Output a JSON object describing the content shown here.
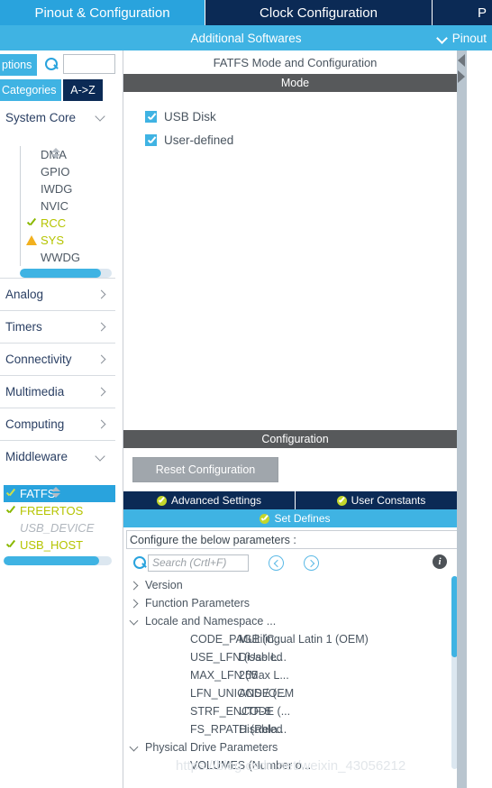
{
  "tabs": [
    {
      "label": "Pinout & Configuration",
      "active": true
    },
    {
      "label": "Clock Configuration",
      "active": false
    },
    {
      "label": "P",
      "active": false
    }
  ],
  "subbar": {
    "title": "Additional Softwares",
    "pinout_label": "Pinout",
    "chevron_icon": "chevron-down-icon"
  },
  "sidebar": {
    "options_label": "ptions",
    "search_value": "",
    "categories_label": "Categories",
    "az_label": "A->Z",
    "groups": [
      {
        "label": "System Core",
        "expanded": true,
        "items": [
          {
            "label": "DMA",
            "state": "none"
          },
          {
            "label": "GPIO",
            "state": "none"
          },
          {
            "label": "IWDG",
            "state": "none"
          },
          {
            "label": "NVIC",
            "state": "none"
          },
          {
            "label": "RCC",
            "state": "ok"
          },
          {
            "label": "SYS",
            "state": "warn"
          },
          {
            "label": "WWDG",
            "state": "none"
          }
        ],
        "scroll_percent": 88
      },
      {
        "label": "Analog",
        "expanded": false,
        "items": []
      },
      {
        "label": "Timers",
        "expanded": false,
        "items": []
      },
      {
        "label": "Connectivity",
        "expanded": false,
        "items": []
      },
      {
        "label": "Multimedia",
        "expanded": false,
        "items": []
      },
      {
        "label": "Computing",
        "expanded": false,
        "items": []
      },
      {
        "label": "Middleware",
        "expanded": true,
        "items": [
          {
            "label": "FATFS",
            "state": "ok",
            "selected": true
          },
          {
            "label": "FREERTOS",
            "state": "ok",
            "selected": false
          },
          {
            "label": "USB_DEVICE",
            "state": "dim",
            "selected": false
          },
          {
            "label": "USB_HOST",
            "state": "ok",
            "selected": false
          }
        ],
        "scroll_percent": 88
      }
    ]
  },
  "main": {
    "panel_title": "FATFS Mode and Configuration",
    "mode": {
      "header": "Mode",
      "checkboxes": [
        {
          "label": "USB Disk",
          "checked": true
        },
        {
          "label": "User-defined",
          "checked": true
        }
      ]
    },
    "configuration": {
      "header": "Configuration",
      "reset_button": "Reset Configuration",
      "tabs": [
        {
          "label": "Advanced Settings",
          "active": false,
          "icon": "check-circle-icon"
        },
        {
          "label": "User Constants",
          "active": false,
          "icon": "check-circle-icon"
        },
        {
          "label": "Set Defines",
          "active": true,
          "icon": "check-circle-icon"
        }
      ],
      "note": "Configure the below parameters :",
      "search_placeholder": "Search (Crtl+F)",
      "search_value": "",
      "prev_icon": "chevron-left-circle-icon",
      "next_icon": "chevron-right-circle-icon",
      "info_icon": "info-icon",
      "info_glyph": "i",
      "tree": [
        {
          "type": "group",
          "label": "Version",
          "expanded": false
        },
        {
          "type": "group",
          "label": "Function Parameters",
          "expanded": false
        },
        {
          "type": "group",
          "label": "Locale and Namespace ...",
          "expanded": true
        },
        {
          "type": "param",
          "name": "CODE_PAGE (C...",
          "value": "Multilingual Latin 1 (OEM)"
        },
        {
          "type": "param",
          "name": "USE_LFN (Use L...",
          "value": "Disabled"
        },
        {
          "type": "param",
          "name": "MAX_LFN (Max L...",
          "value": "255"
        },
        {
          "type": "param",
          "name": "LFN_UNICODE (...",
          "value": "ANSI/OEM"
        },
        {
          "type": "param",
          "name": "STRF_ENCODE (...",
          "value": "UTF-8"
        },
        {
          "type": "param",
          "name": "FS_RPATH (Rela...",
          "value": "Disabled"
        },
        {
          "type": "group",
          "label": "Physical Drive Parameters",
          "expanded": true
        },
        {
          "type": "param",
          "name": "VOLUMES (Number o...",
          "value": ""
        }
      ]
    }
  },
  "watermark": "https://blog.csdn.net/weixin_43056212",
  "colors": {
    "accent_blue": "#3fb3e3",
    "dark_navy": "#0b2a55",
    "section_gray": "#57595b",
    "ok_green": "#b5c400",
    "warn_amber": "#f2b01e"
  }
}
